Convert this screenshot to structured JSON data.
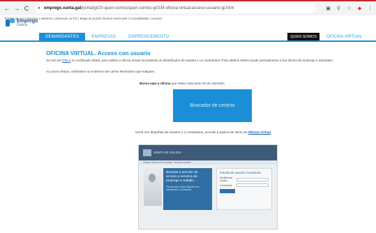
{
  "browser": {
    "url_host": "emprego.xunta.gal",
    "url_path": "/portal/gl/20-quen-somos/quen-somos-gl/334-oficina-virtual-acceso-usuario-gl.html"
  },
  "bookmarks": "Termos de uso | Dereitos e deberes | Sistemas no OC | Mapa do portal | Buscar nesta web | Accesibilidade | Usuario",
  "logo": {
    "line1": "Emprego",
    "line2": "Galicia"
  },
  "nav": {
    "tabs": [
      "DEMANDANTES",
      "EMPRESAS",
      "EMPRENDEMENTO"
    ],
    "quen_somos": "QUEN SOMOS",
    "oficina_virtual": "OFICINA VIRTUAL"
  },
  "content": {
    "title": "OFICINA VIRTUAL. Acceso con usuario",
    "p1_a": "Se non tes ",
    "p1_link": "DNI-e",
    "p1_b": " ou certificado dixital, para utilizar a oficina virtual necesitarás un identificador de usuario e un contrasinal. Para obtelos debes acudir persoalmente á túa oficina de emprego e solicitalos.",
    "p2": "Ao pouco tempo, recibiralos no enderezo de correo electrónico que indiques.",
    "cta_bold": "Busca aquí a oficina",
    "cta_rest": " que estea máis preto do teu domicilio",
    "search_button": "Buscador de centros",
    "after_text": "Unha vez dispoñas do usuario e o contrasinal, accede á páxina de inicio da ",
    "after_link": "Oficina Virtual"
  },
  "login_preview": {
    "brand": "XUNTA DE GALICIA",
    "bar": "Oficina Virtual de Emprego · Acceso usuario",
    "card_title": "Benvido á sección de acceso a servizos de emprego e traballo.",
    "card_sub": "Para acceder debes dispoñer dun identificador e contrasinal",
    "form_title": "Entrada de usuarios rexistrados",
    "label_user": "Identificador usuario",
    "label_pass": "Contrasinal"
  }
}
